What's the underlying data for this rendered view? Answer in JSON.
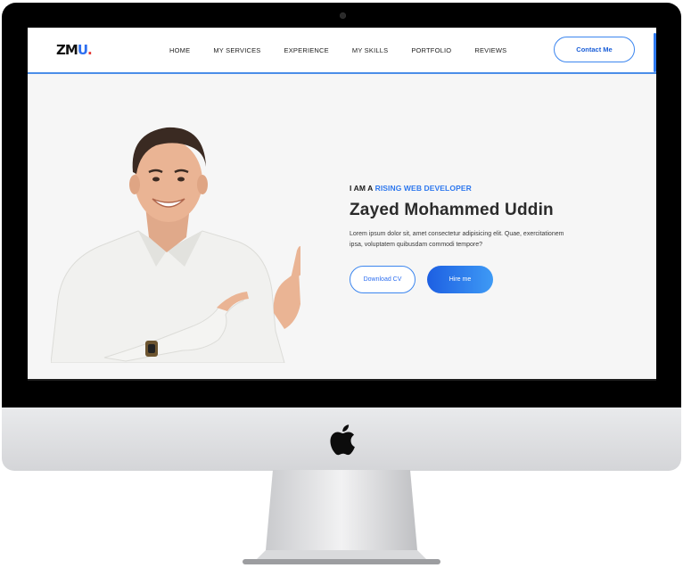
{
  "brand": {
    "logo_main": "ZM",
    "logo_accent": "U",
    "logo_dot": "."
  },
  "nav": {
    "items": [
      "HOME",
      "MY SERVICES",
      "EXPERIENCE",
      "MY SKILLS",
      "PORTFOLIO",
      "REVIEWS"
    ],
    "contact_label": "Contact Me"
  },
  "hero": {
    "tagline_prefix": "I AM A",
    "tagline_accent": "RISING WEB DEVELOPER",
    "name": "Zayed Mohammed Uddin",
    "description": "Lorem ipsum dolor sit, amet consectetur adipisicing elit. Quae, exercitationem ipsa, voluptatem quibusdam commodi tempore?",
    "download_label": "Download CV",
    "hire_label": "Hire me"
  },
  "colors": {
    "accent": "#2e78ee",
    "logo_dot": "#e53935",
    "page_bg": "#f6f6f6",
    "bezel": "#000000"
  },
  "icons": [
    "camera-icon",
    "apple-logo-icon"
  ]
}
